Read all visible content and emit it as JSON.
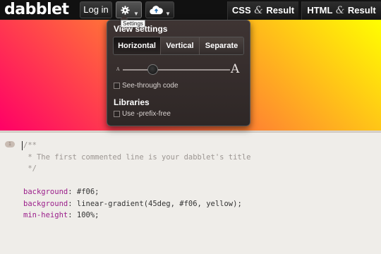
{
  "app": {
    "logo": "dabblet"
  },
  "toolbar": {
    "login_label": "Log in",
    "settings_tooltip": "Settings",
    "views": [
      {
        "left": "CSS",
        "amp": "&",
        "right": "Result"
      },
      {
        "left": "HTML",
        "amp": "&",
        "right": "Result"
      }
    ]
  },
  "settings": {
    "view_heading": "View settings",
    "layout_options": [
      "Horizontal",
      "Vertical",
      "Separate"
    ],
    "selected_layout": "Horizontal",
    "font_small_glyph": "A",
    "font_large_glyph": "A",
    "font_size_level": 0.28,
    "see_through_label": "See-through code",
    "see_through_checked": false,
    "libraries_heading": "Libraries",
    "prefixfree_label": "Use -prefix-free",
    "prefixfree_checked": false
  },
  "editor": {
    "line_badge": "1",
    "lines": [
      {
        "kind": "comment",
        "text": "/**"
      },
      {
        "kind": "comment",
        "text": " * The first commented line is your dabblet's title"
      },
      {
        "kind": "comment",
        "text": " */"
      },
      {
        "kind": "blank",
        "text": ""
      },
      {
        "kind": "decl",
        "prop": "background",
        "value": " #f06;"
      },
      {
        "kind": "decl",
        "prop": "background",
        "value": " linear-gradient(45deg, #f06, yellow);"
      },
      {
        "kind": "decl",
        "prop": "min-height",
        "value": " 100%;"
      }
    ]
  },
  "colors": {
    "result_gradient_start": "#ff0066",
    "result_gradient_end": "#ffff00",
    "css_property": "#9b1e8a",
    "comment": "#9c9692"
  }
}
